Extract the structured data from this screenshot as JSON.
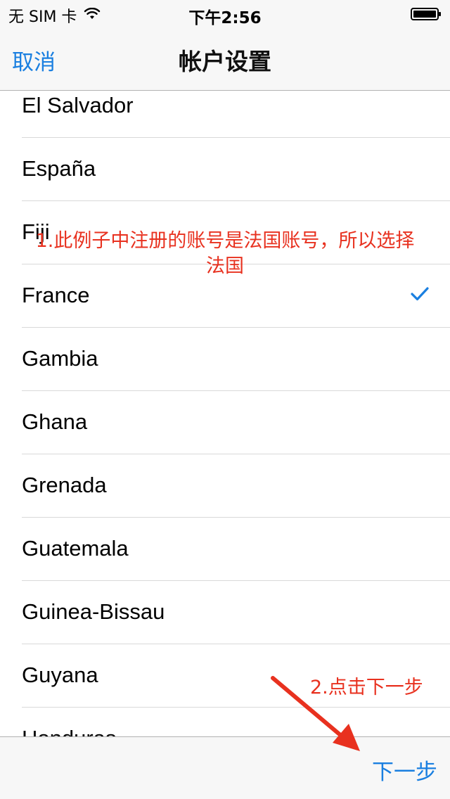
{
  "status_bar": {
    "carrier": "无 SIM 卡",
    "time": "下午2:56",
    "wifi_icon": "wifi-icon",
    "battery_icon": "battery-icon"
  },
  "nav": {
    "cancel_label": "取消",
    "title": "帐户设置"
  },
  "countries": [
    {
      "name": "El Salvador"
    },
    {
      "name": "España"
    },
    {
      "name": "Fiji"
    },
    {
      "name": "France",
      "selected": true
    },
    {
      "name": "Gambia"
    },
    {
      "name": "Ghana"
    },
    {
      "name": "Grenada"
    },
    {
      "name": "Guatemala"
    },
    {
      "name": "Guinea-Bissau"
    },
    {
      "name": "Guyana"
    },
    {
      "name": "Honduras"
    }
  ],
  "toolbar": {
    "next_label": "下一步"
  },
  "annotations": {
    "step1_line1": "1.此例子中注册的账号是法国账号，所以选择",
    "step1_line2": "法国",
    "step2": "2.点击下一步"
  },
  "colors": {
    "accent": "#1a7fe0",
    "annotation": "#e8311f"
  }
}
